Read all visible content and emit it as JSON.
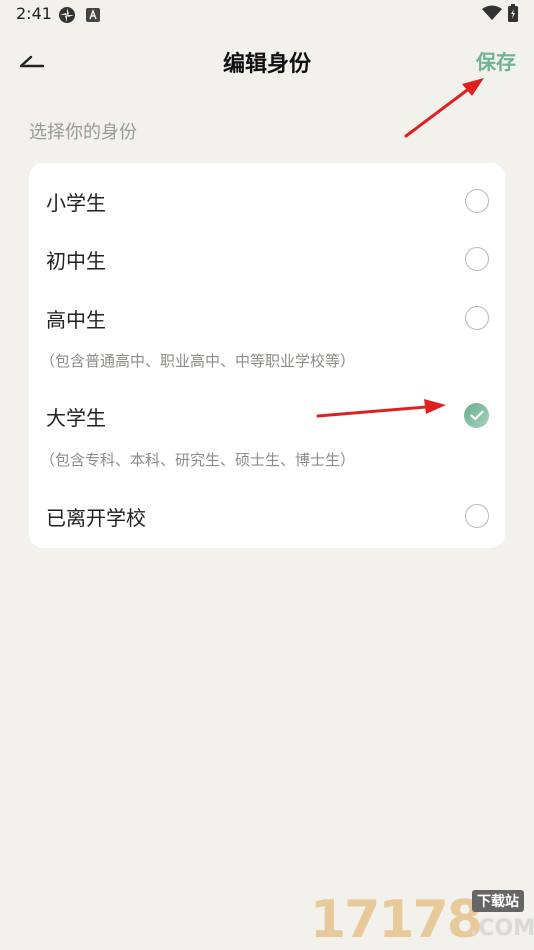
{
  "status_bar": {
    "time": "2:41",
    "icons": [
      "pinwheel-icon",
      "a-badge-icon",
      "wifi-icon",
      "battery-charging-icon"
    ]
  },
  "header": {
    "back_icon": "back-arrow-icon",
    "title": "编辑身份",
    "save_label": "保存"
  },
  "section_label": "选择你的身份",
  "options": [
    {
      "label": "小学生",
      "note": "",
      "selected": false
    },
    {
      "label": "初中生",
      "note": "",
      "selected": false
    },
    {
      "label": "高中生",
      "note": "（包含普通高中、职业高中、中等职业学校等）",
      "selected": false
    },
    {
      "label": "大学生",
      "note": "（包含专科、本科、研究生、硕士生、博士生）",
      "selected": true
    },
    {
      "label": "已离开学校",
      "note": "",
      "selected": false
    }
  ],
  "colors": {
    "accent": "#6fb395",
    "annotation_arrow": "#e02020",
    "background": "#f2f1ec"
  },
  "watermark": {
    "number": "17178",
    "badge": "下载站",
    "suffix": ".COM"
  }
}
